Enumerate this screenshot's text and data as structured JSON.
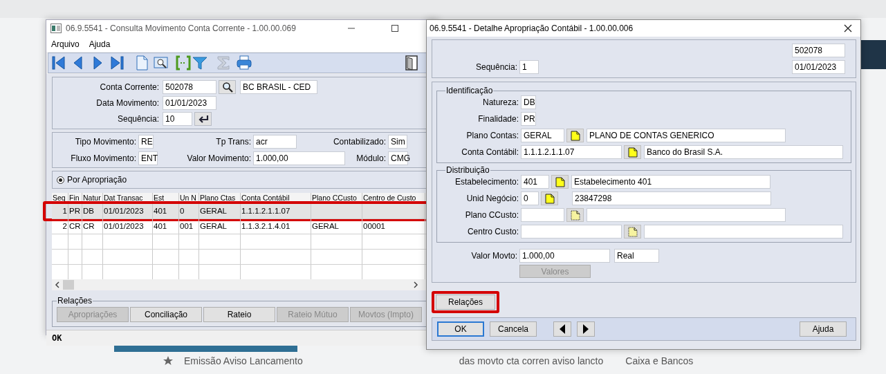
{
  "left_window": {
    "title": "06.9.5541 - Consulta Movimento Conta Corrente - 1.00.00.069",
    "menu": [
      "Arquivo",
      "Ajuda"
    ],
    "toolbar": [
      {
        "kind": "first",
        "disabled": false
      },
      {
        "kind": "prev",
        "disabled": false
      },
      {
        "kind": "next",
        "disabled": false
      },
      {
        "kind": "last",
        "disabled": false
      },
      {
        "kind": "new",
        "disabled": false
      },
      {
        "kind": "view",
        "disabled": false
      },
      {
        "kind": "brackets",
        "disabled": false
      },
      {
        "kind": "filter",
        "disabled": false
      },
      {
        "kind": "sigma",
        "disabled": true
      },
      {
        "kind": "print",
        "disabled": false
      },
      {
        "kind": "exit",
        "disabled": false
      }
    ],
    "header": {
      "conta_corrente": {
        "label": "Conta Corrente:",
        "value": "502078",
        "description": "BC BRASIL - CED"
      },
      "data_movimento": {
        "label": "Data Movimento:",
        "value": "01/01/2023"
      },
      "sequencia": {
        "label": "Sequência:",
        "value": "10"
      }
    },
    "details": [
      {
        "label": "Tipo Movimento:",
        "value": "RE"
      },
      {
        "label": "Tp Trans:",
        "value": "acr"
      },
      {
        "label": "Contabilizado:",
        "value": "Sim"
      },
      {
        "label": "Fluxo Movimento:",
        "value": "ENT"
      },
      {
        "label": "Valor Movimento:",
        "value": "1.000,00"
      },
      {
        "label": "Módulo:",
        "value": "CMG"
      }
    ],
    "radio": {
      "label": "Por Apropriação",
      "checked": true
    },
    "table": {
      "columns": [
        "Seq",
        "Fin",
        "Natur",
        "Dat Transac",
        "Est",
        "Un N",
        "Plano Ctas",
        "Conta Contábil",
        "Plano CCusto",
        "Centro de Custo"
      ],
      "rows": [
        {
          "cells": [
            "1",
            "PR",
            "DB",
            "01/01/2023",
            "401",
            "0",
            "GERAL",
            "1.1.1.2.1.1.07",
            null,
            null
          ],
          "selected": true,
          "highlighted": true
        },
        {
          "cells": [
            "2",
            "CR",
            "CR",
            "01/01/2023",
            "401",
            "001",
            "GERAL",
            "1.1.3.2.1.4.01",
            "GERAL",
            "00001"
          ],
          "selected": false,
          "highlighted": false
        }
      ]
    },
    "relations": {
      "title": "Relações",
      "buttons": [
        {
          "label": "Apropriações",
          "disabled": true
        },
        {
          "label": "Conciliação",
          "disabled": false
        },
        {
          "label": "Rateio",
          "disabled": false
        },
        {
          "label": "Rateio Mútuo",
          "disabled": true
        },
        {
          "label": "Movtos (Impto)",
          "disabled": true
        }
      ]
    },
    "status": "OK"
  },
  "dialog": {
    "title": "06.9.5541 - Detalhe Apropriação Contábil - 1.00.00.006",
    "top": {
      "code": "502078",
      "date": "01/01/2023",
      "sequencia": {
        "label": "Sequência:",
        "value": "1"
      }
    },
    "groups": [
      {
        "title": "Identificação",
        "fields": [
          {
            "kind": "plain",
            "label": "Natureza:",
            "value": "DB"
          },
          {
            "kind": "plain",
            "label": "Finalidade:",
            "value": "PR"
          },
          {
            "kind": "lookup",
            "label": "Plano Contas:",
            "value": "GERAL",
            "description": "PLANO DE CONTAS GENERICO",
            "lookup_disabled": false
          },
          {
            "kind": "lookup",
            "label": "Conta Contábil:",
            "value": "1.1.1.2.1.1.07",
            "description": "Banco do Brasil S.A.",
            "lookup_disabled": false
          }
        ]
      },
      {
        "title": "Distribuição",
        "fields": [
          {
            "kind": "lookup",
            "label": "Estabelecimento:",
            "value": "401",
            "description": "Estabelecimento 401",
            "lookup_disabled": false
          },
          {
            "kind": "lookup",
            "label": "Unid Negócio:",
            "value": "0",
            "description": "23847298",
            "lookup_disabled": false
          },
          {
            "kind": "lookup",
            "label": "Plano CCusto:",
            "lookup_disabled": true
          },
          {
            "kind": "lookup",
            "label": "Centro Custo:",
            "lookup_disabled": true
          }
        ]
      }
    ],
    "valor": {
      "label": "Valor Movto:",
      "value": "1.000,00",
      "currency": "Real"
    },
    "valores_button": {
      "label": "Valores",
      "disabled": true
    },
    "relations_button": {
      "label": "Relações",
      "highlighted": true
    },
    "footer": {
      "ok": {
        "label": "OK",
        "default": true
      },
      "cancel": {
        "label": "Cancela"
      },
      "help": {
        "label": "Ajuda"
      }
    }
  },
  "background": {
    "items": [
      "Emissão Aviso Lancamento",
      "das movto cta corren aviso lancto",
      "Caixa e Bancos"
    ]
  }
}
